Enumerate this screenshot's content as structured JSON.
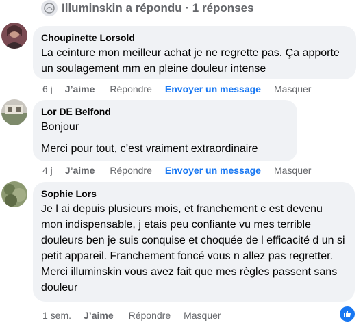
{
  "thread": {
    "reply_summary": "Illuminskin a répondu · 1 réponses"
  },
  "comments": [
    {
      "author": "Choupinette Lorsold",
      "lines": [
        "La ceinture mon meilleur achat je ne regrette pas. Ça apporte un soulagement mm en pleine douleur intense"
      ],
      "time": "6 j",
      "like": "J’aime",
      "reply": "Répondre",
      "message": "Envoyer un message",
      "hide": "Masquer"
    },
    {
      "author": "Lor DE Belfond",
      "lines": [
        "Bonjour",
        "Merci pour tout, c’est vraiment extraordinaire"
      ],
      "time": "4 j",
      "like": "J’aime",
      "reply": "Répondre",
      "message": "Envoyer un message",
      "hide": "Masquer"
    },
    {
      "author": "Sophie Lors",
      "lines": [
        "Je l ai depuis plusieurs mois, et franchement c est devenu mon indispensable, j etais peu confiante vu mes terrible douleurs ben je suis conquise et choquée de l efficacité d un si petit appareil. Franchement foncé vous n allez pas regretter. Merci illuminskin vous avez fait que mes règles passent sans douleur"
      ],
      "time": "1 sem.",
      "like": "J’aime",
      "reply": "Répondre",
      "hide": "Masquer",
      "reaction_icon": "thumbs-up-icon"
    }
  ]
}
